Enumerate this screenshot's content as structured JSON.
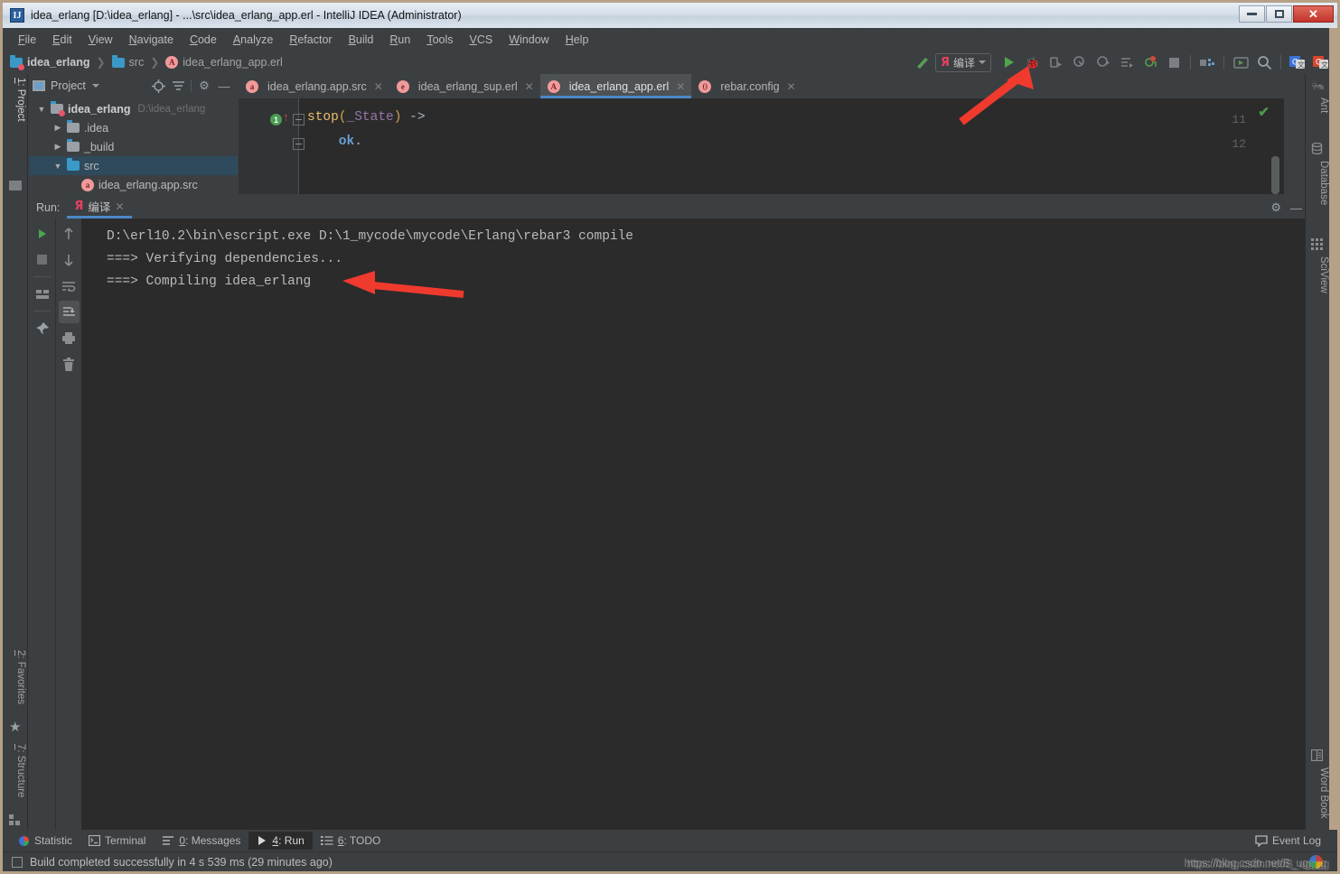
{
  "window": {
    "title": "idea_erlang [D:\\idea_erlang] - ...\\src\\idea_erlang_app.erl - IntelliJ IDEA (Administrator)",
    "app_icon": "IJ",
    "minimize_label": "–",
    "maximize_label": "□",
    "close_label": "✕"
  },
  "menubar": {
    "items": [
      {
        "pre": "F",
        "rest": "ile"
      },
      {
        "pre": "E",
        "rest": "dit"
      },
      {
        "pre": "V",
        "rest": "iew"
      },
      {
        "pre": "N",
        "rest": "avigate"
      },
      {
        "pre": "C",
        "rest": "ode"
      },
      {
        "pre": "A",
        "rest": "nalyze"
      },
      {
        "pre": "R",
        "rest": "efactor"
      },
      {
        "pre": "B",
        "rest": "uild"
      },
      {
        "pre": "R",
        "rest": "un"
      },
      {
        "pre": "T",
        "rest": "ools"
      },
      {
        "pre": "V",
        "rest": "CS"
      },
      {
        "pre": "W",
        "rest": "indow"
      },
      {
        "pre": "H",
        "rest": "elp"
      }
    ]
  },
  "breadcrumb": {
    "items": [
      "idea_erlang",
      "src",
      "idea_erlang_app.erl"
    ],
    "file_badge": "A",
    "separator": "❯"
  },
  "toolbar": {
    "run_config": {
      "glyph": "Я",
      "label": "编译"
    },
    "buttons": [
      {
        "name": "build-hammer-icon",
        "glyph": "⬉"
      },
      {
        "name": "run-button",
        "glyph": "▶"
      },
      {
        "name": "debug-button",
        "glyph": "🐞"
      },
      {
        "name": "run-with-coverage-button",
        "glyph": "▷"
      },
      {
        "name": "profile-button",
        "glyph": "◔"
      },
      {
        "name": "attach-profiler-button",
        "glyph": "◑"
      },
      {
        "name": "run-multiple-button",
        "glyph": "≡"
      },
      {
        "name": "stop-debug-button",
        "glyph": "⬤"
      },
      {
        "name": "stop-button",
        "glyph": "■"
      },
      {
        "name": "project-structure-button",
        "glyph": "▤"
      },
      {
        "name": "run-anything-button",
        "glyph": "▷"
      },
      {
        "name": "search-everywhere-icon",
        "glyph": "⚲"
      },
      {
        "name": "translate-google-button",
        "glyph": "G"
      },
      {
        "name": "translate-alt-button",
        "glyph": "G"
      }
    ]
  },
  "project_panel": {
    "title": "Project",
    "header_icons": [
      "target-icon",
      "collapse-all-icon",
      "gear-icon",
      "hide-icon"
    ],
    "tree": [
      {
        "indent": 0,
        "twisty": "▼",
        "icon": "module-folder-icon",
        "label": "idea_erlang",
        "path": "D:\\idea_erlang",
        "bold": true,
        "selected": false
      },
      {
        "indent": 1,
        "twisty": "▶",
        "icon": "folder-icon",
        "label": ".idea",
        "path": "",
        "bold": false,
        "selected": false
      },
      {
        "indent": 1,
        "twisty": "▶",
        "icon": "folder-icon",
        "label": "_build",
        "path": "",
        "bold": false,
        "selected": false
      },
      {
        "indent": 1,
        "twisty": "▼",
        "icon": "source-folder-icon",
        "label": "src",
        "path": "",
        "bold": false,
        "selected": true
      },
      {
        "indent": 2,
        "twisty": "",
        "icon": "app-src-file-icon",
        "label": "idea_erlang.app.src",
        "path": "",
        "bold": false,
        "selected": false
      }
    ]
  },
  "editor_tabs": [
    {
      "badge": "a",
      "label": "idea_erlang.app.src",
      "active": false,
      "close": "✕"
    },
    {
      "badge": "e",
      "label": "idea_erlang_sup.erl",
      "active": false,
      "close": "✕"
    },
    {
      "badge": "A",
      "label": "idea_erlang_app.erl",
      "active": true,
      "close": "✕"
    },
    {
      "badge": "()",
      "label": "rebar.config",
      "active": false,
      "close": "✕"
    }
  ],
  "editor": {
    "lines": [
      {
        "num": "11",
        "gutter_badge": "1",
        "gutter_arrow": "↑",
        "tokens": [
          {
            "cls": "c-fn",
            "t": "stop"
          },
          {
            "cls": "c-pn",
            "t": "("
          },
          {
            "cls": "c-var",
            "t": "_State"
          },
          {
            "cls": "c-pn",
            "t": ")"
          },
          {
            "cls": "c-arrow",
            "t": " ->"
          }
        ]
      },
      {
        "num": "12",
        "gutter_badge": "",
        "gutter_arrow": "",
        "tokens": [
          {
            "cls": "c-atom",
            "t": "    ok"
          },
          {
            "cls": "c-dot",
            "t": "."
          }
        ]
      }
    ],
    "inspection_status": "✔"
  },
  "run_panel": {
    "label": "Run:",
    "tab": {
      "glyph": "Я",
      "label": "编译",
      "close": "✕"
    },
    "header_right": [
      "gear-icon",
      "minimize-icon"
    ],
    "left_tools": [
      {
        "name": "rerun-button",
        "glyph": "▶",
        "kind": "play"
      },
      {
        "name": "stop-process-button",
        "glyph": "■",
        "kind": "stop"
      },
      {
        "name": "sep",
        "glyph": "",
        "kind": "sep"
      },
      {
        "name": "layout-settings-button",
        "glyph": "▤",
        "kind": "icon"
      },
      {
        "name": "sep",
        "glyph": "",
        "kind": "sep"
      },
      {
        "name": "pin-tab-button",
        "glyph": "📌",
        "kind": "icon"
      }
    ],
    "right_tools": [
      {
        "name": "previous-occurrence-button",
        "glyph": "↑",
        "boxed": false
      },
      {
        "name": "next-occurrence-button",
        "glyph": "↓",
        "boxed": false
      },
      {
        "name": "soft-wrap-button",
        "glyph": "↵",
        "boxed": false
      },
      {
        "name": "scroll-to-end-button",
        "glyph": "↧",
        "boxed": true
      },
      {
        "name": "print-button",
        "glyph": "⎙",
        "boxed": false
      },
      {
        "name": "clear-all-button",
        "glyph": "🗑",
        "boxed": false
      }
    ],
    "console_lines": [
      "D:\\erl10.2\\bin\\escript.exe D:\\1_mycode\\mycode\\Erlang\\rebar3 compile",
      "===> Verifying dependencies...",
      "===> Compiling idea_erlang"
    ]
  },
  "left_strip": {
    "tabs": [
      {
        "name": "sidebar-item-project",
        "pre": "1",
        "label": ": Project",
        "active": true
      },
      {
        "name": "sidebar-item-favorites",
        "pre": "2",
        "label": ": Favorites",
        "active": false
      },
      {
        "name": "sidebar-item-structure",
        "pre": "7",
        "label": ": Structure",
        "active": false
      }
    ]
  },
  "right_strip": {
    "tabs": [
      {
        "name": "sidebar-item-ant",
        "label": "Ant",
        "icon": "ant-icon"
      },
      {
        "name": "sidebar-item-database",
        "label": "Database",
        "icon": "database-icon"
      },
      {
        "name": "sidebar-item-sciview",
        "label": "SciView",
        "icon": "grid-icon"
      },
      {
        "name": "sidebar-item-word-book",
        "label": "Word Book",
        "icon": "book-icon"
      }
    ]
  },
  "statusbar": {
    "items": [
      {
        "name": "status-statistic",
        "icon": "statistic-icon",
        "pre": "",
        "label": "Statistic",
        "active": false
      },
      {
        "name": "status-terminal",
        "icon": "terminal-icon",
        "pre": "",
        "label": "Terminal",
        "active": false
      },
      {
        "name": "status-messages",
        "icon": "messages-icon",
        "pre": "0",
        "label": ": Messages",
        "active": false
      },
      {
        "name": "status-run",
        "icon": "run-icon",
        "pre": "4",
        "label": ": Run",
        "active": true
      },
      {
        "name": "status-todo",
        "icon": "todo-icon",
        "pre": "6",
        "label": ": TODO",
        "active": false
      }
    ],
    "event_log": "Event Log"
  },
  "message_bar": {
    "text": "Build completed successfully in 4 s 539 ms (29 minutes ago)"
  },
  "watermark": {
    "text": "https://blog.csdn.net/B_ugggg"
  },
  "colors": {
    "accent_blue": "#4a88c7",
    "panel_bg": "#3c3f41",
    "editor_bg": "#2b2b2b",
    "selection_blue": "#0d293e",
    "annotation_red": "#f03a2e",
    "run_green": "#4ca64c",
    "config_pink": "#e8415f"
  }
}
